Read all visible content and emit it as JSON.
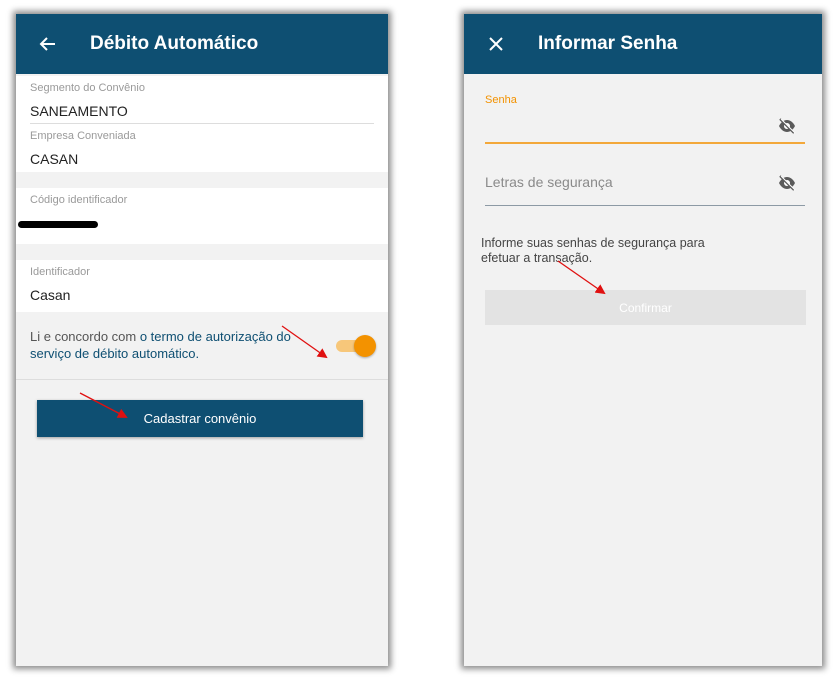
{
  "debito_screen": {
    "title": "Débito Automático",
    "back_icon": "arrow-left-icon",
    "fields": {
      "segmento_label": "Segmento do Convênio",
      "segmento_value": "SANEAMENTO",
      "empresa_label": "Empresa Conveniada",
      "empresa_value": "CASAN",
      "codigo_label": "Código identificador",
      "identificador_label": "Identificador",
      "identificador_value": "Casan"
    },
    "terms": {
      "prefix": "Li e concordo com ",
      "link": "o termo de autorização do serviço de débito automático.",
      "toggle_on": true
    },
    "submit_label": "Cadastrar convênio"
  },
  "senha_screen": {
    "title": "Informar Senha",
    "close_icon": "close-icon",
    "senha_label": "Senha",
    "letras_placeholder": "Letras de segurança",
    "eye_icon": "eye-off-icon",
    "info": "Informe suas senhas de segurança para efetuar a transação.",
    "confirm_label": "Confirmar"
  },
  "colors": {
    "primary": "#0e4f72",
    "accent": "#f39200",
    "annotation_arrow": "#e01010"
  }
}
